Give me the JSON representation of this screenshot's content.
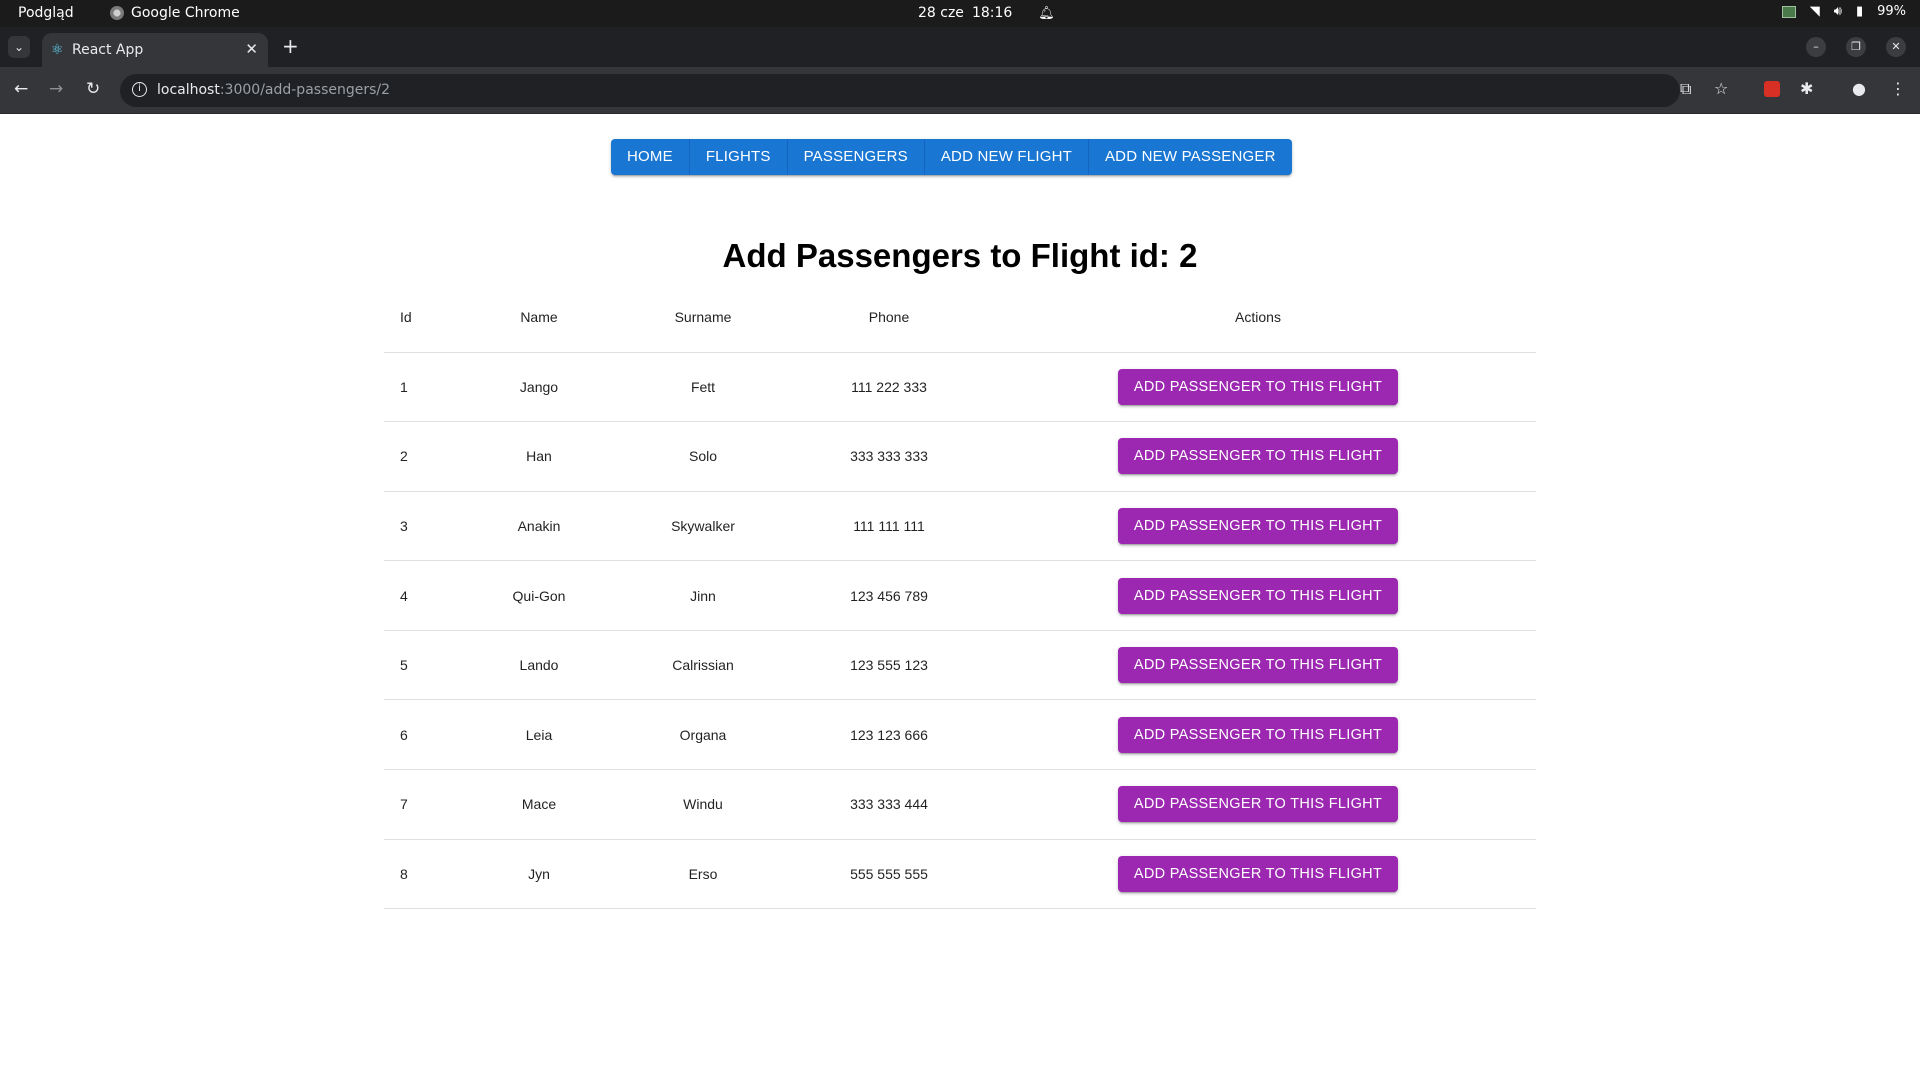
{
  "os_bar": {
    "activities_label": "Podgląd",
    "app_name": "Google Chrome",
    "date": "28 cze",
    "time": "18:16",
    "battery": "99%"
  },
  "browser": {
    "tab_title": "React App",
    "url_host": "localhost",
    "url_path": ":3000/add-passengers/2"
  },
  "nav": {
    "items": [
      "HOME",
      "FLIGHTS",
      "PASSENGERS",
      "ADD NEW FLIGHT",
      "ADD NEW PASSENGER"
    ],
    "color": "#1976d2"
  },
  "page": {
    "title": "Add Passengers to Flight id: 2"
  },
  "table": {
    "headers": {
      "id": "Id",
      "name": "Name",
      "surname": "Surname",
      "phone": "Phone",
      "actions": "Actions"
    },
    "action_label": "ADD PASSENGER TO THIS FLIGHT",
    "action_color": "#9c27b0",
    "rows": [
      {
        "id": "1",
        "name": "Jango",
        "surname": "Fett",
        "phone": "111 222 333"
      },
      {
        "id": "2",
        "name": "Han",
        "surname": "Solo",
        "phone": "333 333 333"
      },
      {
        "id": "3",
        "name": "Anakin",
        "surname": "Skywalker",
        "phone": "111 111 111"
      },
      {
        "id": "4",
        "name": "Qui-Gon",
        "surname": "Jinn",
        "phone": "123 456 789"
      },
      {
        "id": "5",
        "name": "Lando",
        "surname": "Calrissian",
        "phone": "123 555 123"
      },
      {
        "id": "6",
        "name": "Leia",
        "surname": "Organa",
        "phone": "123 123 666"
      },
      {
        "id": "7",
        "name": "Mace",
        "surname": "Windu",
        "phone": "333 333 444"
      },
      {
        "id": "8",
        "name": "Jyn",
        "surname": "Erso",
        "phone": "555 555 555"
      }
    ]
  }
}
